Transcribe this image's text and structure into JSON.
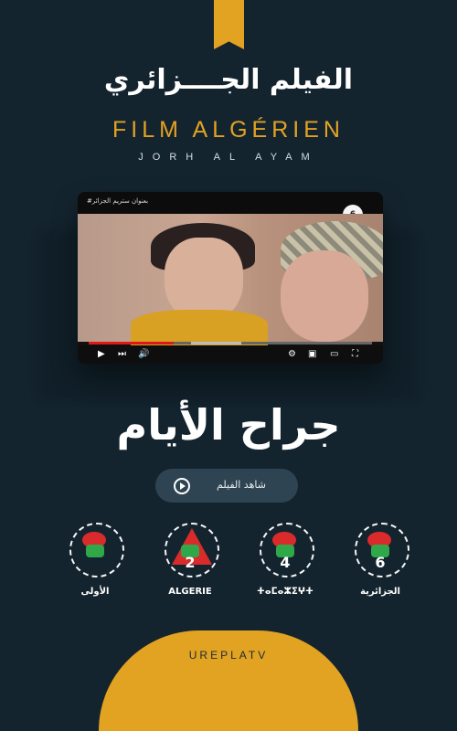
{
  "header": {
    "title_ar": "الفيلم الجــــزائري",
    "title_fr": "FILM ALGÉRIEN",
    "subtitle": "JORH AL AYAM"
  },
  "video": {
    "overlay_text": "#بعنوان ستريم الجزائر",
    "channel_badge": "6",
    "controls": [
      "play-icon",
      "next-icon",
      "volume-icon",
      "settings-icon",
      "miniplayer-icon",
      "theater-icon",
      "fullscreen-icon"
    ]
  },
  "movie": {
    "title": "جراح الأيام",
    "watch_label": "شاهد الفيلم"
  },
  "channels": [
    {
      "number": "",
      "tag": "الأولى"
    },
    {
      "number": "2",
      "tag": "ALGERIE"
    },
    {
      "number": "4",
      "tag": "ⵜⴰⵎⴰⵣⵉⵖⵜ"
    },
    {
      "number": "6",
      "tag": "الجزائرية"
    }
  ],
  "footer": {
    "brand": "UREPLATV"
  },
  "colors": {
    "background": "#14242f",
    "accent": "#e2a222",
    "button": "#2f4452"
  }
}
